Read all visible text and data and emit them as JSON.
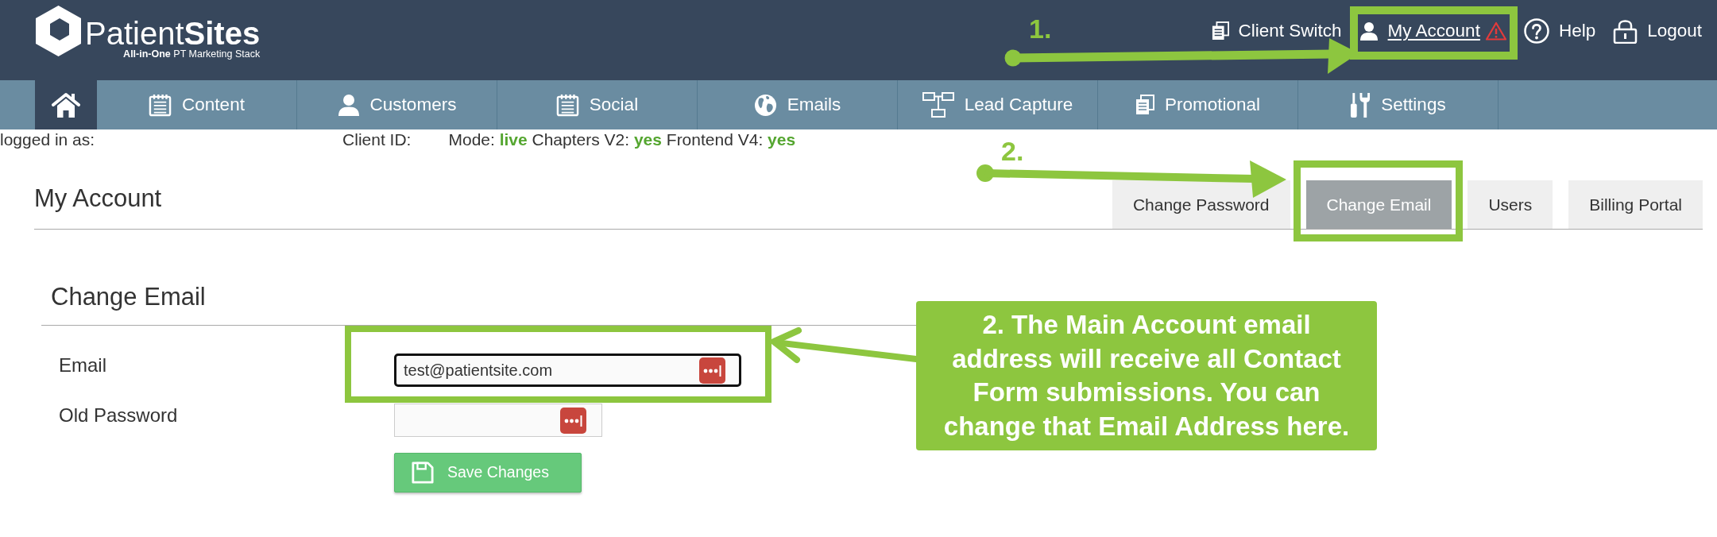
{
  "header": {
    "logo": {
      "wordmark": "Patient**Sites**",
      "tagline": "**All-in-One** PT Marketing Stack"
    },
    "links": [
      {
        "label": "Client Switch",
        "selected": false,
        "alert": false,
        "highlighted": false
      },
      {
        "label": "My Account",
        "selected": true,
        "alert": true,
        "highlighted": true
      },
      {
        "label": "Help",
        "selected": false,
        "alert": false,
        "highlighted": false
      },
      {
        "label": "Logout",
        "selected": false,
        "alert": false,
        "highlighted": false
      }
    ]
  },
  "nav": {
    "items": [
      {
        "kind": "home",
        "selected": true
      },
      {
        "kind": "label",
        "label": "Content",
        "selected": false
      },
      {
        "kind": "label",
        "label": "Customers",
        "selected": false
      },
      {
        "kind": "label",
        "label": "Social",
        "selected": false
      },
      {
        "kind": "label",
        "label": "Emails",
        "selected": false
      },
      {
        "kind": "label",
        "label": "Lead Capture",
        "selected": false
      },
      {
        "kind": "label",
        "label": "Promotional",
        "selected": false
      },
      {
        "kind": "label",
        "label": "Settings",
        "selected": false
      }
    ]
  },
  "session": {
    "logged_in": "logged in as:",
    "client_id": "Client ID:",
    "flags": "Mode: **live** Chapters V2: **yes** Frontend V4: **yes**"
  },
  "page": {
    "title": "My Account",
    "tabs": [
      {
        "label": "Change Password",
        "selected": false,
        "highlighted": false
      },
      {
        "label": "Change Email",
        "selected": true,
        "highlighted": true
      },
      {
        "label": "Users",
        "selected": false,
        "highlighted": false
      },
      {
        "label": "Billing Portal",
        "selected": false,
        "highlighted": false
      }
    ]
  },
  "form": {
    "title": "Change Email",
    "fields": [
      {
        "label": "Email",
        "value": "test@patientsite.com",
        "focused": true,
        "highlighted": true
      },
      {
        "label": "Old Password",
        "focused": false,
        "highlighted": false
      }
    ],
    "submit": {
      "label": "Save Changes"
    }
  },
  "annotations": {
    "steps": [
      {
        "number": "1."
      },
      {
        "number": "2."
      }
    ],
    "callout": {
      "text": "2. The Main Account email address will receive all Contact Form submissions. You can change that Email Address here."
    }
  }
}
